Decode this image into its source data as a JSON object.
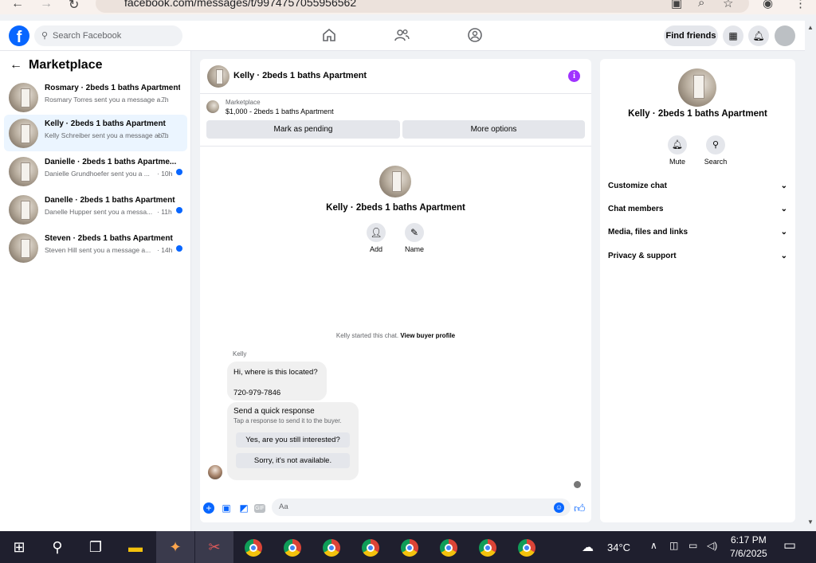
{
  "browser": {
    "url": "facebook.com/messages/t/9974757055956562",
    "back_icon": "←",
    "forward_icon": "→",
    "reload_icon": "↻"
  },
  "topbar": {
    "logo": "f",
    "search_placeholder": "Search Facebook",
    "find_friends_label": "Find friends"
  },
  "marketplace": {
    "title": "Marketplace",
    "threads": [
      {
        "title": "Rosmary · 2beds 1 baths Apartment",
        "preview": "Rosmary Torres sent you a message a...",
        "time": "· 7h",
        "unread": false,
        "active": false
      },
      {
        "title": "Kelly · 2beds 1 baths Apartment",
        "preview": "Kelly Schreiber sent you a message ab...",
        "time": "· 7h",
        "unread": false,
        "active": true
      },
      {
        "title": "Danielle · 2beds 1 baths Apartme...",
        "preview": "Danielle Grundhoefer sent you a ...",
        "time": "· 10h",
        "unread": true,
        "active": false
      },
      {
        "title": "Danelle · 2beds 1 baths Apartment",
        "preview": "Danelle Hupper sent you a messa...",
        "time": "· 11h",
        "unread": true,
        "active": false
      },
      {
        "title": "Steven · 2beds 1 baths Apartment",
        "preview": "Steven Hill sent you a message a...",
        "time": "· 14h",
        "unread": true,
        "active": false
      }
    ]
  },
  "conversation": {
    "title": "Kelly · 2beds 1 baths Apartment",
    "info_icon": "i",
    "listing_label": "Marketplace",
    "listing_price": "$1,000 - 2beds 1 baths Apartment",
    "mark_pending_label": "Mark as pending",
    "more_options_label": "More options",
    "profile_name": "Kelly · 2beds 1 baths Apartment",
    "add_label": "Add",
    "name_label": "Name",
    "started_text": "Kelly started this chat.",
    "view_profile_label": "View buyer profile",
    "sender_name": "Kelly",
    "message_line1": "Hi, where is this located?",
    "message_line2": "720-979-7846",
    "quick_title": "Send a quick response",
    "quick_subtitle": "Tap a response to send it to the buyer.",
    "quick_reply_1": "Yes, are you still interested?",
    "quick_reply_2": "Sorry, it's not available.",
    "composer_placeholder": "Aa",
    "gif_label": "GIF"
  },
  "details": {
    "name": "Kelly · 2beds 1 baths Apartment",
    "mute_label": "Mute",
    "search_label": "Search",
    "sections": [
      "Customize chat",
      "Chat members",
      "Media, files and links",
      "Privacy & support"
    ]
  },
  "taskbar": {
    "temperature": "34°C",
    "time": "6:17 PM",
    "date": "7/6/2025"
  },
  "colors": {
    "brand_blue": "#0866ff",
    "active_thread_bg": "#ebf5ff",
    "info_purple": "#a033ff",
    "taskbar_bg": "#1f1f2e"
  }
}
